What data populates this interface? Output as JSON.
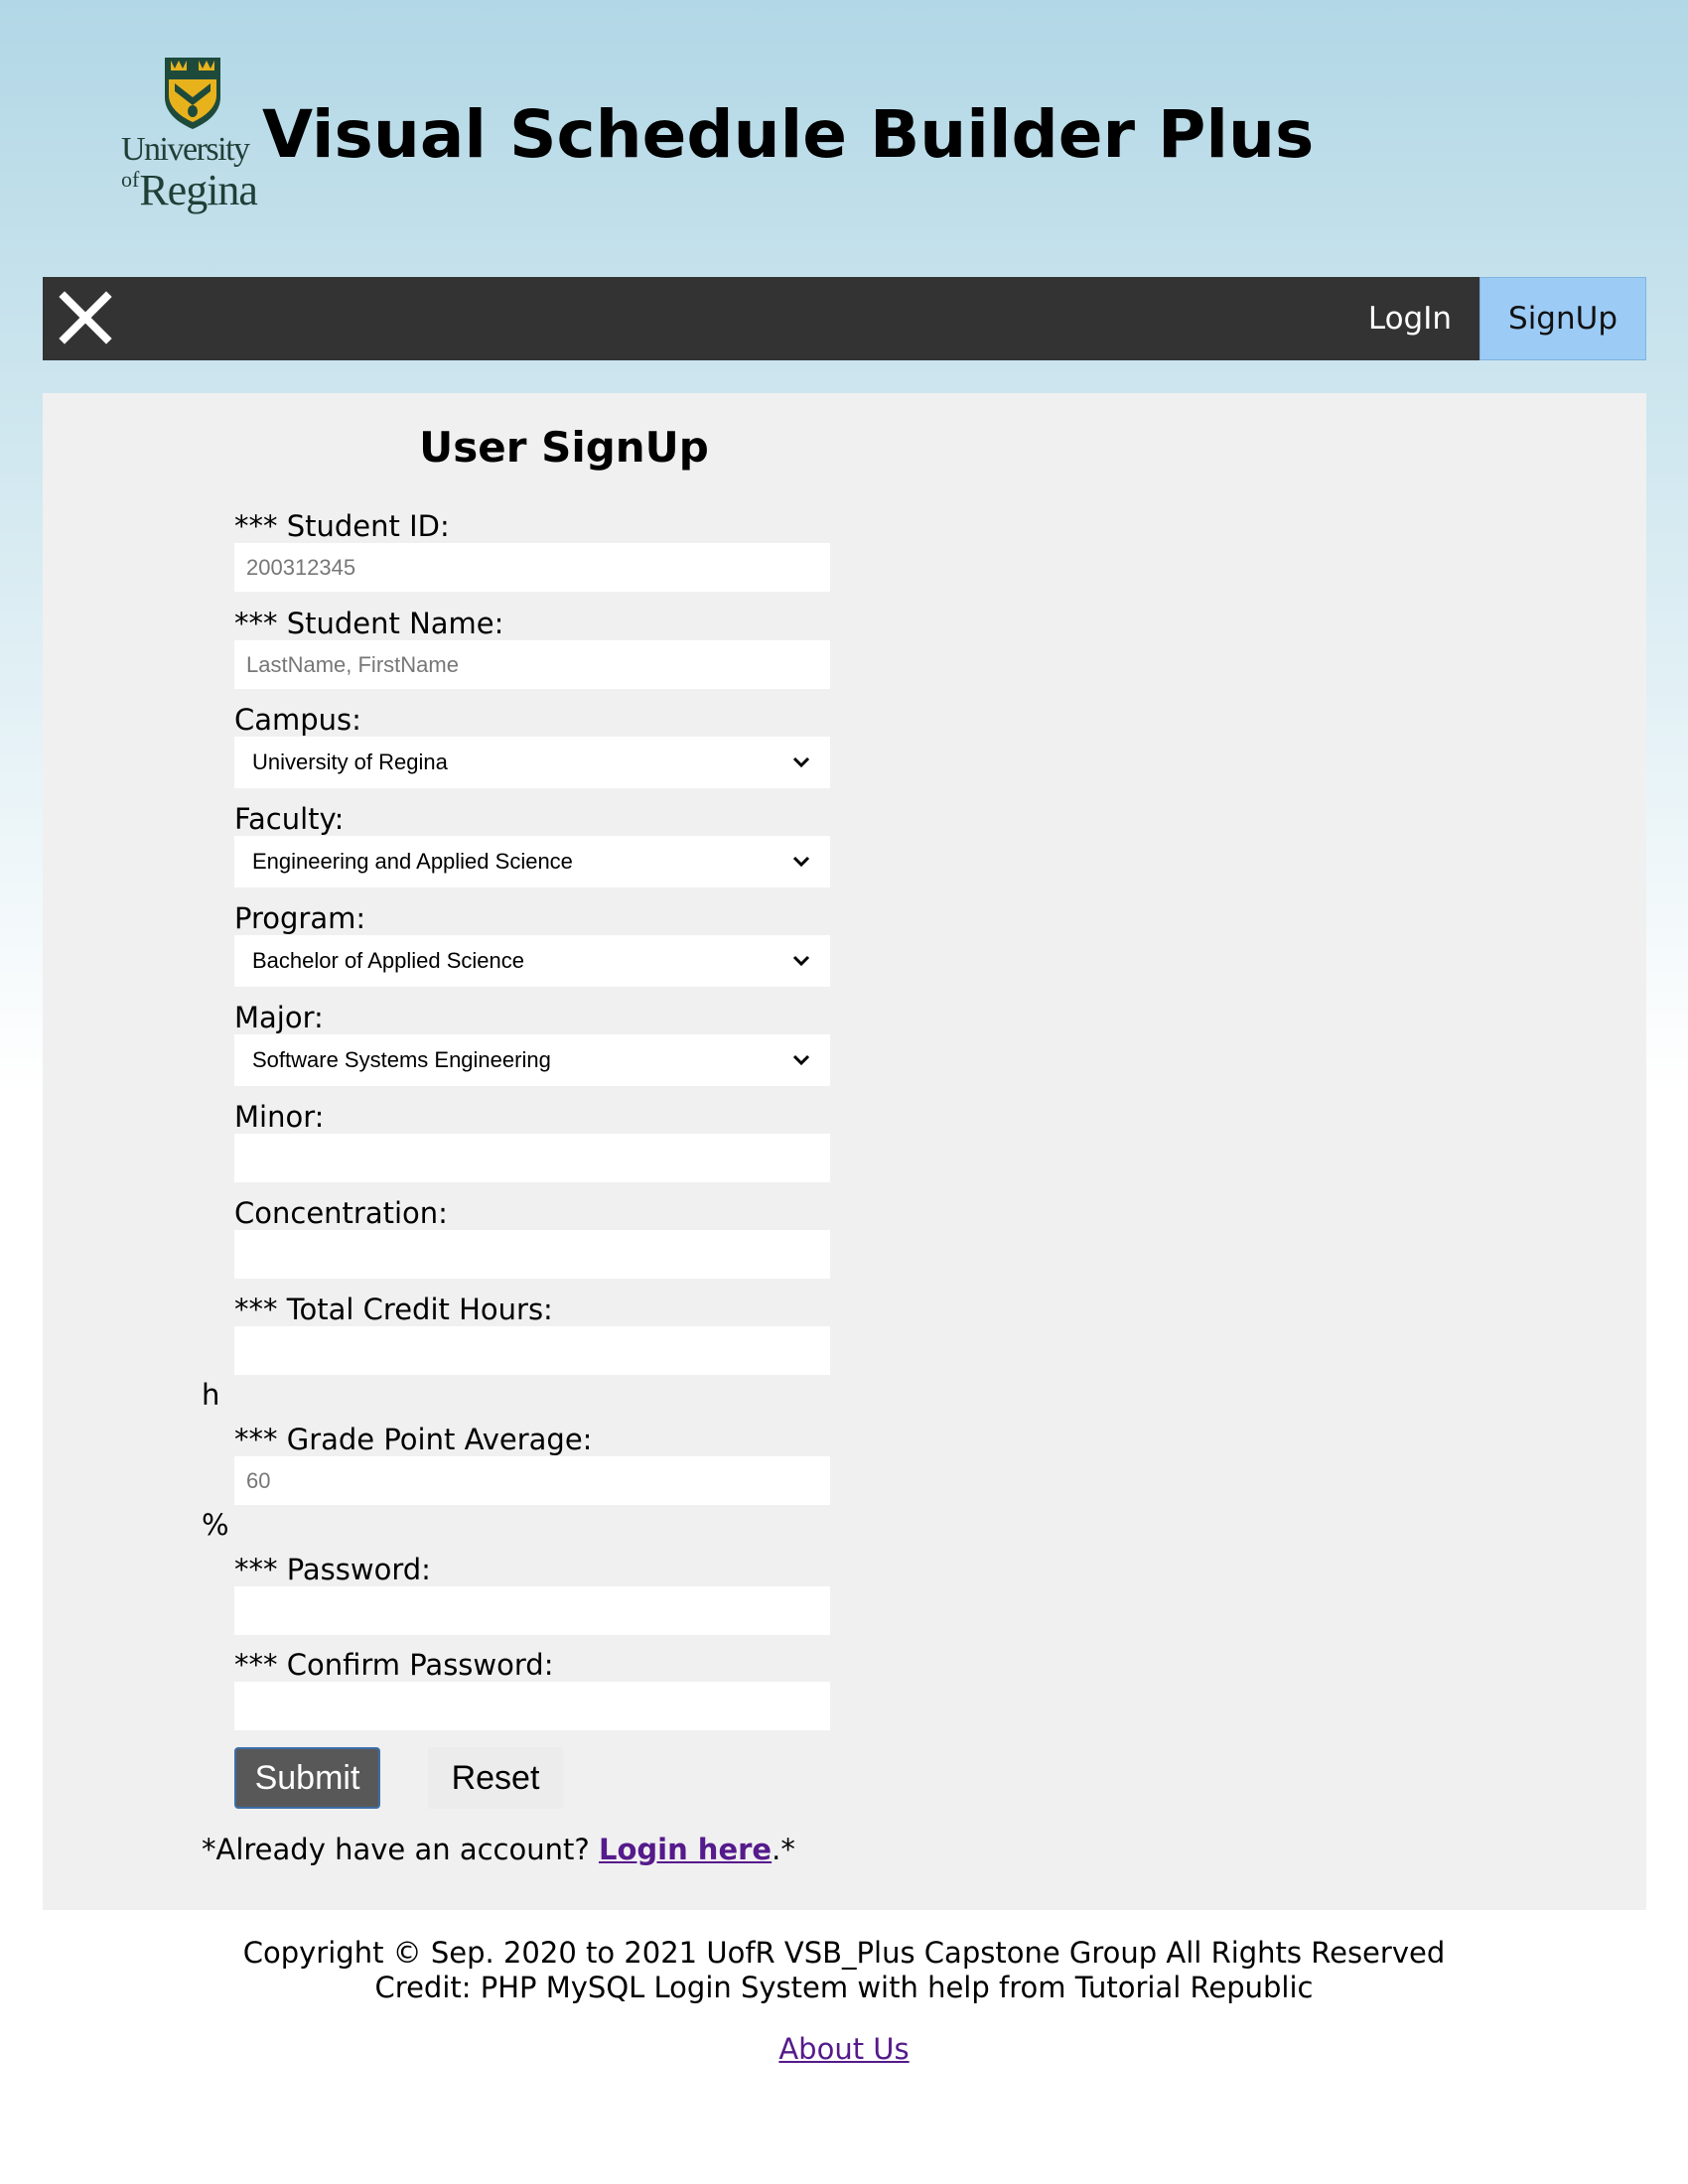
{
  "header": {
    "logo_line1": "University",
    "logo_of": "of",
    "logo_regina": "Regina",
    "title": "Visual Schedule Builder Plus"
  },
  "nav": {
    "close_icon": "close-icon",
    "login_label": "LogIn",
    "signup_label": "SignUp",
    "active": "SignUp"
  },
  "form": {
    "title": "User SignUp",
    "student_id": {
      "label": "*** Student ID:",
      "value": "",
      "placeholder": "200312345"
    },
    "student_name": {
      "label": "*** Student Name:",
      "value": "",
      "placeholder": "LastName, FirstName"
    },
    "campus": {
      "label": "Campus:",
      "selected": "University of Regina"
    },
    "faculty": {
      "label": "Faculty:",
      "selected": "Engineering and Applied Science"
    },
    "program": {
      "label": "Program:",
      "selected": "Bachelor of Applied Science"
    },
    "major": {
      "label": "Major:",
      "selected": "Software Systems Engineering"
    },
    "minor": {
      "label": "Minor:",
      "value": ""
    },
    "concentration": {
      "label": "Concentration:",
      "value": ""
    },
    "credit_hours": {
      "label": "*** Total Credit Hours:",
      "value": "",
      "unit": "h"
    },
    "gpa": {
      "label": "*** Grade Point Average:",
      "value": "",
      "placeholder": "60",
      "unit": "%"
    },
    "password": {
      "label": "*** Password:",
      "value": ""
    },
    "confirm_password": {
      "label": "*** Confirm Password:",
      "value": ""
    },
    "submit_label": "Submit",
    "reset_label": "Reset",
    "login_prefix": "*Already have an account? ",
    "login_link": "Login here",
    "login_suffix": ".*"
  },
  "footer": {
    "copyright": "Copyright © Sep. 2020 to 2021 UofR VSB_Plus Capstone Group All Rights Reserved",
    "credit": "Credit: PHP MySQL Login System with help from Tutorial Republic",
    "about_link": "About Us"
  },
  "colors": {
    "navbar_bg": "#333333",
    "active_nav_bg": "#9ccbf5",
    "panel_bg": "#f0f0f0",
    "submit_bg": "#585858",
    "link_color": "#551a8b"
  }
}
